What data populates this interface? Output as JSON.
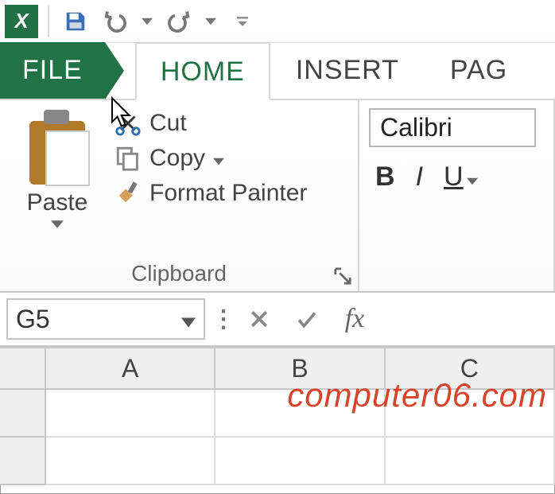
{
  "qat": {
    "app_name": "Excel"
  },
  "tabs": {
    "file": "FILE",
    "home": "HOME",
    "insert": "INSERT",
    "page": "PAG"
  },
  "ribbon": {
    "clipboard": {
      "paste_label": "Paste",
      "cut_label": "Cut",
      "copy_label": "Copy",
      "format_painter_label": "Format Painter",
      "group_label": "Clipboard"
    },
    "font": {
      "font_name": "Calibri",
      "bold": "B",
      "italic": "I",
      "underline": "U"
    }
  },
  "namebox": {
    "value": "G5"
  },
  "formula_bar": {
    "fx_label": "fx"
  },
  "columns": [
    "A",
    "B",
    "C"
  ],
  "watermark": "computer06.com"
}
